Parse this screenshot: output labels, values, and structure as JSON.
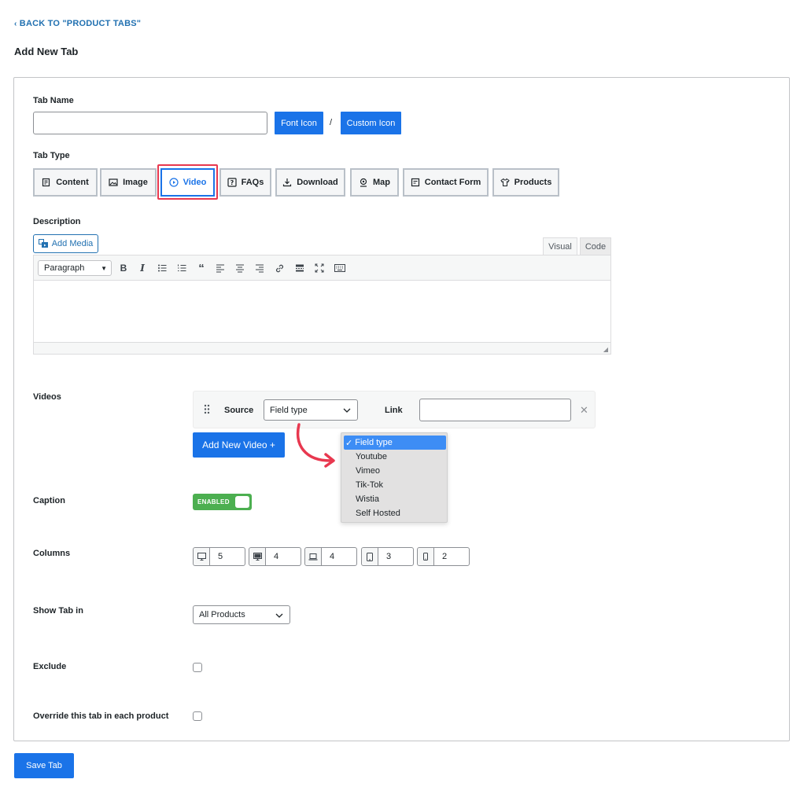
{
  "header": {
    "back_link": "BACK TO \"PRODUCT TABS\"",
    "page_title": "Add New Tab"
  },
  "tab_name": {
    "label": "Tab Name",
    "value": "",
    "font_icon_label": "Font Icon",
    "separator": "/",
    "custom_icon_label": "Custom Icon"
  },
  "tab_type": {
    "label": "Tab Type",
    "options": [
      {
        "label": "Content",
        "icon": "content-icon"
      },
      {
        "label": "Image",
        "icon": "image-icon"
      },
      {
        "label": "Video",
        "icon": "play-icon"
      },
      {
        "label": "FAQs",
        "icon": "question-icon"
      },
      {
        "label": "Download",
        "icon": "download-icon"
      },
      {
        "label": "Map",
        "icon": "map-pin-icon"
      },
      {
        "label": "Contact Form",
        "icon": "form-icon"
      },
      {
        "label": "Products",
        "icon": "shirt-icon"
      }
    ],
    "selected": "Video"
  },
  "description": {
    "label": "Description",
    "add_media_label": "Add Media",
    "visual_tab": "Visual",
    "code_tab": "Code",
    "format_select": "Paragraph"
  },
  "videos": {
    "label": "Videos",
    "source_label": "Source",
    "source_value": "Field type",
    "link_label": "Link",
    "link_value": "",
    "add_new_label": "Add New Video +",
    "dropdown_options": [
      "Field type",
      "Youtube",
      "Vimeo",
      "Tik-Tok",
      "Wistia",
      "Self Hosted"
    ],
    "dropdown_selected": "Field type"
  },
  "caption": {
    "label": "Caption",
    "toggle_text": "ENABLED"
  },
  "columns": {
    "label": "Columns",
    "values": [
      "5",
      "4",
      "4",
      "3",
      "2"
    ]
  },
  "show_tab_in": {
    "label": "Show Tab in",
    "value": "All Products"
  },
  "exclude": {
    "label": "Exclude"
  },
  "override": {
    "label": "Override this tab in each product"
  },
  "footer": {
    "save_label": "Save Tab"
  },
  "colors": {
    "primary": "#1a73e8",
    "link": "#2271b1",
    "highlight": "#e8384f",
    "toggle_on": "#4caf50"
  }
}
